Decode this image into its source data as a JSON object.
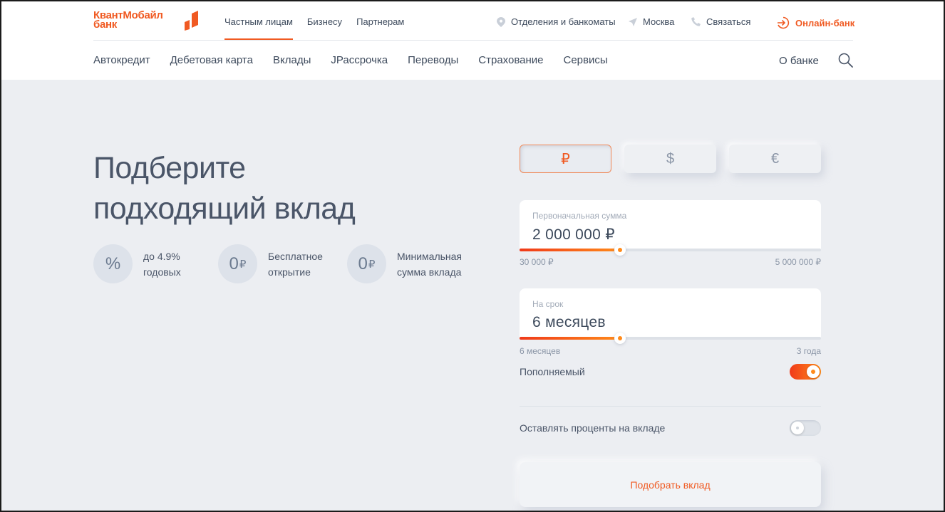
{
  "brand": {
    "line1": "КвантМобайл",
    "line2": "банк",
    "accent": "#f05a22"
  },
  "segments": [
    {
      "label": "Частным лицам",
      "active": true
    },
    {
      "label": "Бизнесу",
      "active": false
    },
    {
      "label": "Партнерам",
      "active": false
    }
  ],
  "utility": {
    "branches": {
      "label": "Отделения и банкоматы",
      "icon": "location-pin-icon"
    },
    "city": {
      "label": "Москва",
      "icon": "navigation-arrow-icon"
    },
    "contact": {
      "label": "Связаться",
      "icon": "phone-icon"
    },
    "online_bank": {
      "label": "Онлайн-банк",
      "icon": "login-icon"
    }
  },
  "main_nav": [
    "Автокредит",
    "Дебетовая карта",
    "Вклады",
    "JРассрочка",
    "Переводы",
    "Страхование",
    "Сервисы"
  ],
  "about_label": "О банке",
  "search_icon": "search-icon",
  "hero": {
    "title_line1": "Подберите",
    "title_line2": "подходящий вклад"
  },
  "features": [
    {
      "icon_text": "%",
      "line1": "до 4.9%",
      "line2": "годовых"
    },
    {
      "icon_text": "0",
      "icon_suffix": "₽",
      "line1": "Бесплатное",
      "line2": "открытие"
    },
    {
      "icon_text": "0",
      "icon_suffix": "₽",
      "line1": "Минимальная",
      "line2": "сумма вклада"
    }
  ],
  "currencies": [
    {
      "symbol": "₽",
      "selected": true
    },
    {
      "symbol": "$",
      "selected": false
    },
    {
      "symbol": "€",
      "selected": false
    }
  ],
  "amount": {
    "label": "Первоначальная сумма",
    "value": "2 000 000 ₽",
    "min_label": "30 000 ₽",
    "max_label": "5 000 000 ₽",
    "slider_fraction": 0.334
  },
  "term": {
    "label": "На срок",
    "value": "6 месяцев",
    "min_label": "6 месяцев",
    "max_label": "3 года",
    "slider_fraction": 0.334
  },
  "options": {
    "replenishable": {
      "label": "Пополняемый",
      "on": true
    },
    "keep_interest": {
      "label": "Оставлять проценты на вкладе",
      "on": false
    }
  },
  "submit_label": "Подобрать вклад"
}
